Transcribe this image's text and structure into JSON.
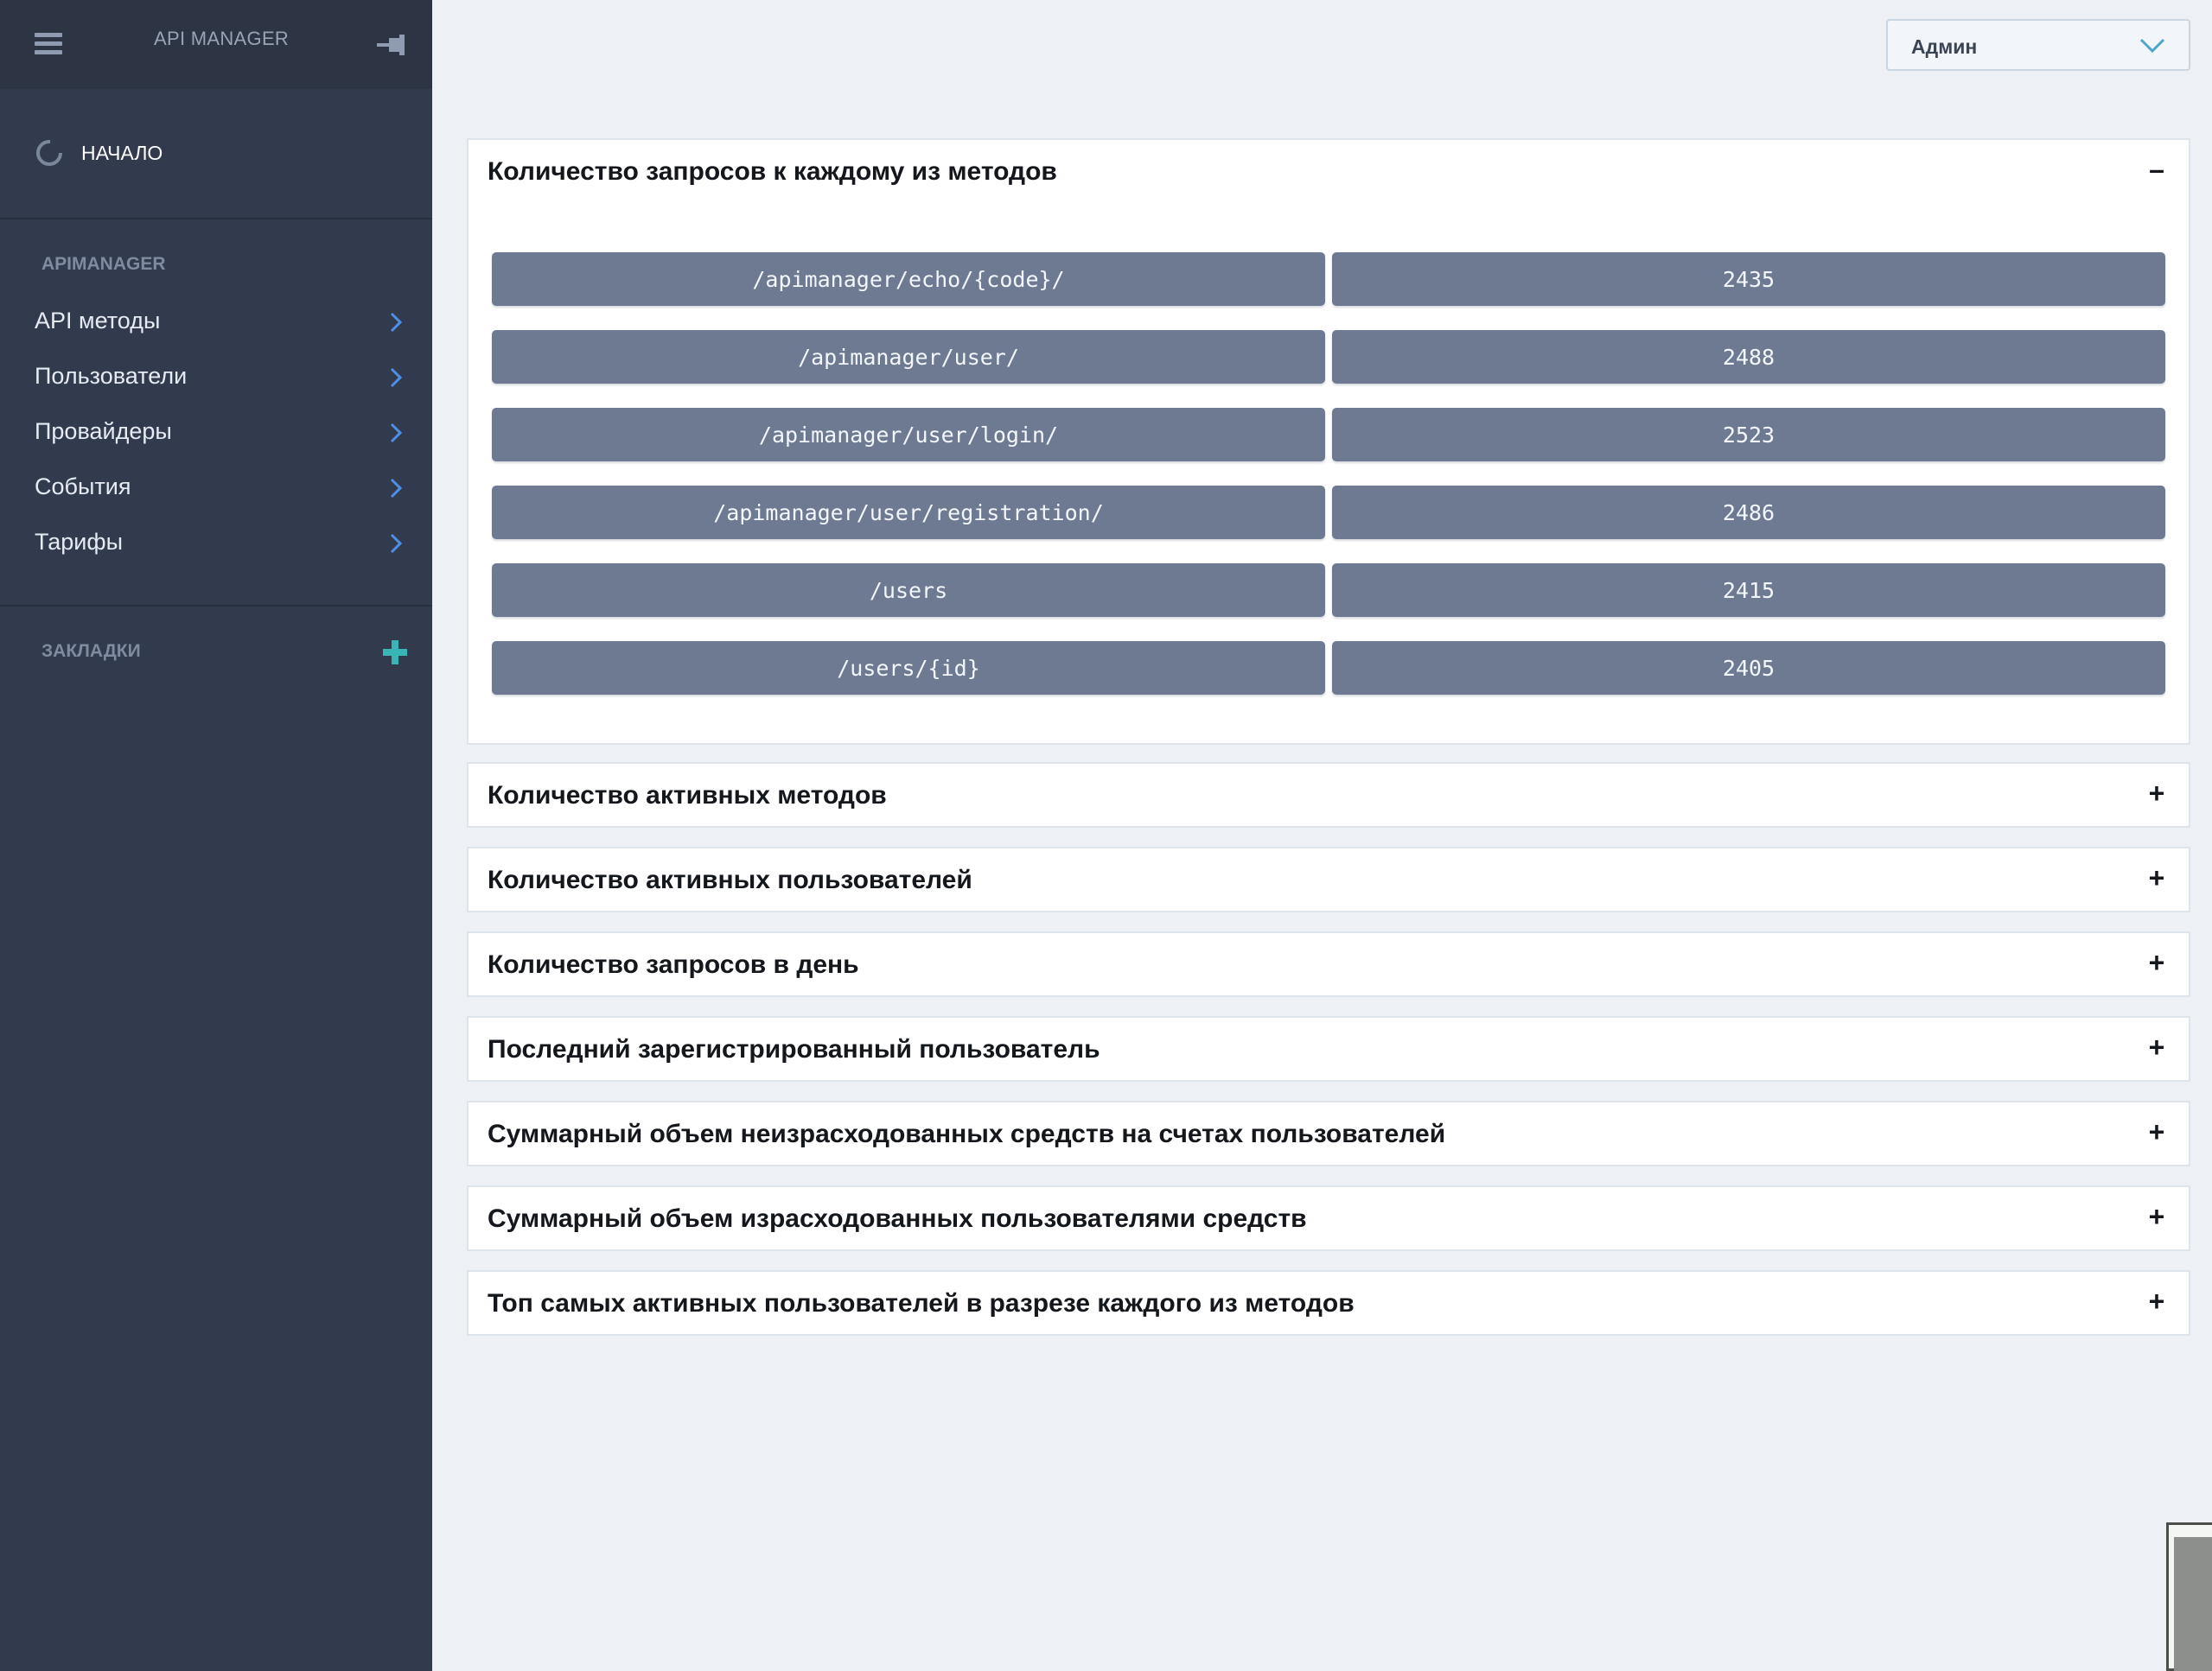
{
  "app": {
    "title": "API MANAGER"
  },
  "sidebar": {
    "home_label": "НАЧАЛО",
    "section_title": "APIMANAGER",
    "items": [
      {
        "label": "API методы"
      },
      {
        "label": "Пользователи"
      },
      {
        "label": "Провайдеры"
      },
      {
        "label": "События"
      },
      {
        "label": "Тарифы"
      }
    ],
    "bookmarks_title": "ЗАКЛАДКИ"
  },
  "header": {
    "user_select_value": "Админ"
  },
  "panels": [
    {
      "title": "Количество запросов к каждому из методов",
      "toggle": "–",
      "expanded": true,
      "rows": [
        {
          "method": "/apimanager/echo/{code}/",
          "count": "2435"
        },
        {
          "method": "/apimanager/user/",
          "count": "2488"
        },
        {
          "method": "/apimanager/user/login/",
          "count": "2523"
        },
        {
          "method": "/apimanager/user/registration/",
          "count": "2486"
        },
        {
          "method": "/users",
          "count": "2415"
        },
        {
          "method": "/users/{id}",
          "count": "2405"
        }
      ]
    },
    {
      "title": "Количество активных методов",
      "toggle": "+"
    },
    {
      "title": "Количество активных пользователей",
      "toggle": "+"
    },
    {
      "title": "Количество запросов в день",
      "toggle": "+"
    },
    {
      "title": "Последний зарегистрированный пользователь",
      "toggle": "+"
    },
    {
      "title": "Суммарный объем неизрасходованных средств на счетах пользователей",
      "toggle": "+"
    },
    {
      "title": "Суммарный объем израсходованных пользователями средств",
      "toggle": "+"
    },
    {
      "title": "Топ самых активных пользователей в разрезе каждого из методов",
      "toggle": "+"
    }
  ],
  "colors": {
    "sidebar_bg": "#323b4d",
    "content_bg": "#edf1f6",
    "row_bg": "#6d7a92",
    "accent_chevron": "#4f8fe8",
    "accent_plus": "#3ab5b5"
  },
  "icons": [
    "menu-icon",
    "pin-icon",
    "home-spinner-icon",
    "chevron-right-icon",
    "plus-icon",
    "chevron-down-icon"
  ]
}
